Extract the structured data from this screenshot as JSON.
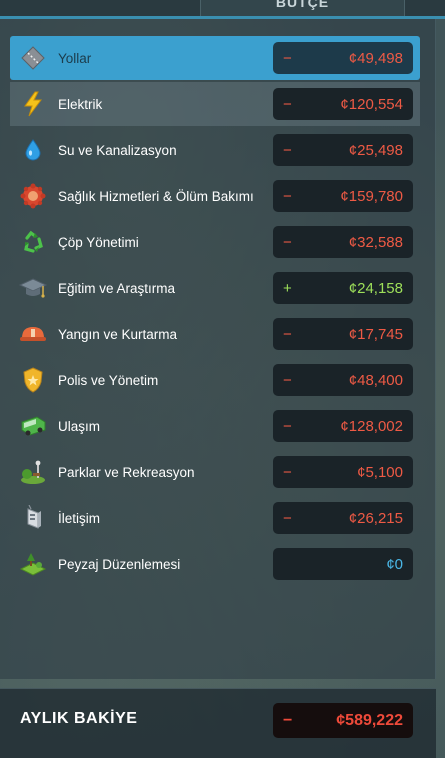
{
  "header": {
    "tab_title": "BÜTÇE"
  },
  "colors": {
    "negative": "#ee5a45",
    "positive": "#9ee05a",
    "zero": "#4ab8e8",
    "selected_row": "#3ba0cf"
  },
  "rows": [
    {
      "label": "Yollar",
      "sign": "−",
      "amount": "¢49,498",
      "tone": "neg",
      "icon": "road-icon",
      "state": "selected"
    },
    {
      "label": "Elektrik",
      "sign": "−",
      "amount": "¢120,554",
      "tone": "neg",
      "icon": "lightning-icon",
      "state": "hover"
    },
    {
      "label": "Su ve Kanalizasyon",
      "sign": "−",
      "amount": "¢25,498",
      "tone": "neg",
      "icon": "water-drop-icon",
      "state": ""
    },
    {
      "label": "Sağlık Hizmetleri & Ölüm Bakımı",
      "sign": "−",
      "amount": "¢159,780",
      "tone": "neg",
      "icon": "healthcare-icon",
      "state": ""
    },
    {
      "label": "Çöp Yönetimi",
      "sign": "−",
      "amount": "¢32,588",
      "tone": "neg",
      "icon": "recycle-icon",
      "state": ""
    },
    {
      "label": "Eğitim ve Araştırma",
      "sign": "+",
      "amount": "¢24,158",
      "tone": "pos",
      "icon": "graduation-cap-icon",
      "state": ""
    },
    {
      "label": "Yangın ve Kurtarma",
      "sign": "−",
      "amount": "¢17,745",
      "tone": "neg",
      "icon": "fire-helmet-icon",
      "state": ""
    },
    {
      "label": "Polis ve Yönetim",
      "sign": "−",
      "amount": "¢48,400",
      "tone": "neg",
      "icon": "police-badge-icon",
      "state": ""
    },
    {
      "label": "Ulaşım",
      "sign": "−",
      "amount": "¢128,002",
      "tone": "neg",
      "icon": "bus-icon",
      "state": ""
    },
    {
      "label": "Parklar ve Rekreasyon",
      "sign": "−",
      "amount": "¢5,100",
      "tone": "neg",
      "icon": "park-icon",
      "state": ""
    },
    {
      "label": "İletişim",
      "sign": "−",
      "amount": "¢26,215",
      "tone": "neg",
      "icon": "communication-icon",
      "state": ""
    },
    {
      "label": "Peyzaj Düzenlemesi",
      "sign": "",
      "amount": "¢0",
      "tone": "zero",
      "icon": "landscaping-icon",
      "state": ""
    }
  ],
  "footer": {
    "label": "AYLIK BAKİYE",
    "sign": "−",
    "amount": "¢589,222"
  }
}
